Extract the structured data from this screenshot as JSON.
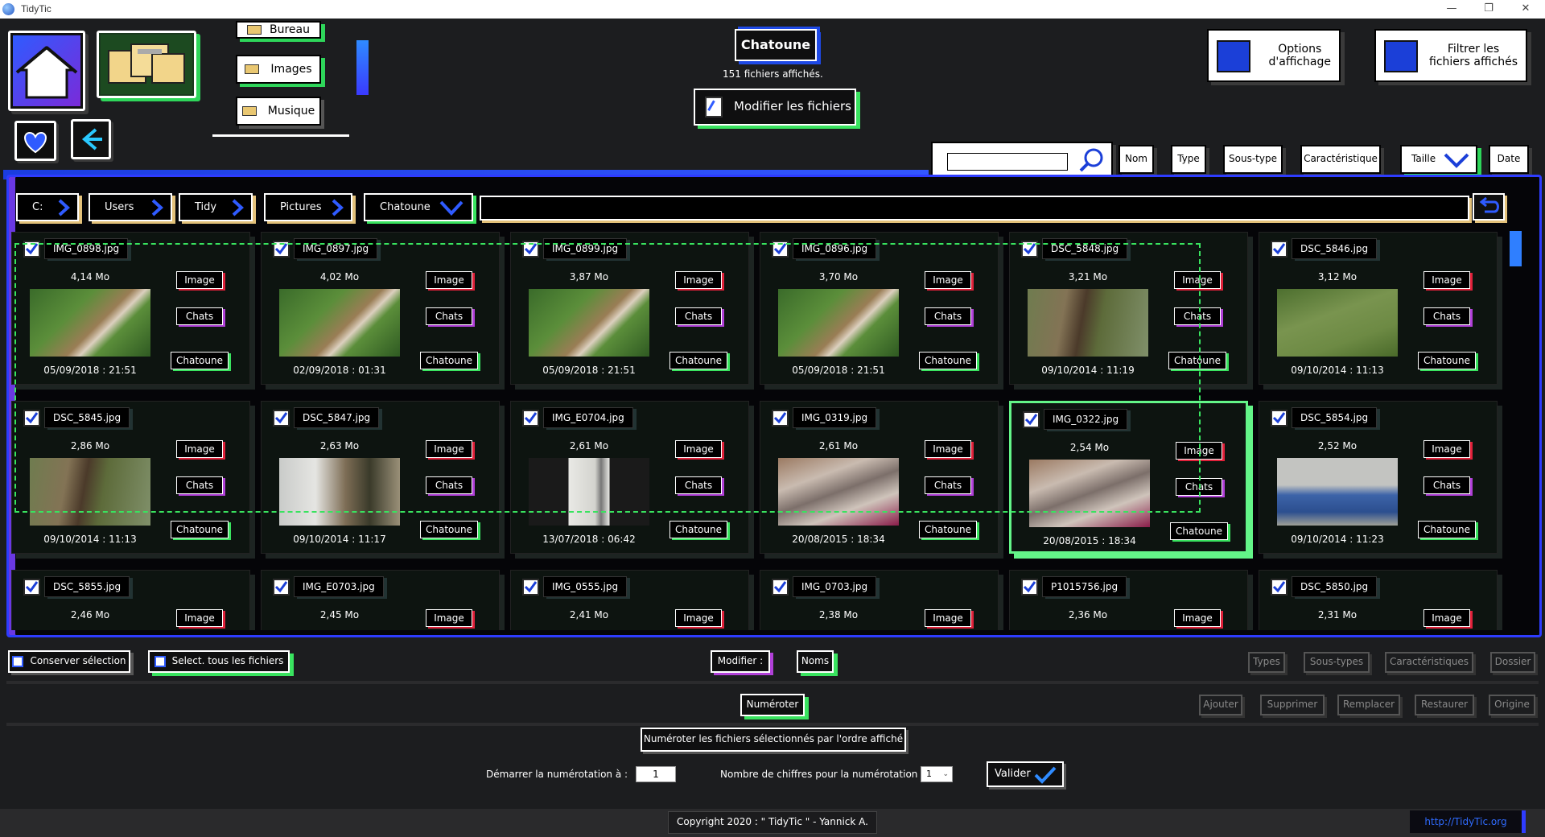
{
  "window": {
    "title": "TidyTic",
    "minimize": "—",
    "restore": "❐",
    "close": "✕"
  },
  "nav": {
    "shortcuts": [
      "Bureau",
      "Images",
      "Musique"
    ]
  },
  "current_folder": {
    "name": "Chatoune",
    "count_text": "151 fichiers affichés."
  },
  "actions": {
    "modify_files": "Modifier les fichiers"
  },
  "top_right": {
    "display_options": "Options\nd'affichage",
    "filter_files": "Filtrer les\nfichiers affichés"
  },
  "sort_buttons": [
    "Nom",
    "Type",
    "Sous-type",
    "Caractéristique",
    "Taille",
    "Date"
  ],
  "search": {
    "value": "",
    "placeholder": ""
  },
  "breadcrumb": [
    "C:",
    "Users",
    "Tidy",
    "Pictures",
    "Chatoune"
  ],
  "files": [
    {
      "name": "IMG_0898.jpg",
      "size": "4,14 Mo",
      "date": "05/09/2018 : 21:51",
      "type": "Image",
      "subtype": "Chats",
      "char": "Chatoune",
      "thumb": "garden"
    },
    {
      "name": "IMG_0897.jpg",
      "size": "4,02 Mo",
      "date": "02/09/2018 : 01:31",
      "type": "Image",
      "subtype": "Chats",
      "char": "Chatoune",
      "thumb": "garden"
    },
    {
      "name": "IMG_0899.jpg",
      "size": "3,87 Mo",
      "date": "05/09/2018 : 21:51",
      "type": "Image",
      "subtype": "Chats",
      "char": "Chatoune",
      "thumb": "garden"
    },
    {
      "name": "IMG_0896.jpg",
      "size": "3,70 Mo",
      "date": "05/09/2018 : 21:51",
      "type": "Image",
      "subtype": "Chats",
      "char": "Chatoune",
      "thumb": "garden"
    },
    {
      "name": "DSC_5848.jpg",
      "size": "3,21 Mo",
      "date": "09/10/2014 : 11:19",
      "type": "Image",
      "subtype": "Chats",
      "char": "Chatoune",
      "thumb": "tree"
    },
    {
      "name": "DSC_5846.jpg",
      "size": "3,12 Mo",
      "date": "09/10/2014 : 11:13",
      "type": "Image",
      "subtype": "Chats",
      "char": "Chatoune",
      "thumb": "grass"
    },
    {
      "name": "DSC_5845.jpg",
      "size": "2,86 Mo",
      "date": "09/10/2014 : 11:13",
      "type": "Image",
      "subtype": "Chats",
      "char": "Chatoune",
      "thumb": "tree"
    },
    {
      "name": "DSC_5847.jpg",
      "size": "2,63 Mo",
      "date": "09/10/2014 : 11:17",
      "type": "Image",
      "subtype": "Chats",
      "char": "Chatoune",
      "thumb": "yard"
    },
    {
      "name": "IMG_E0704.jpg",
      "size": "2,61 Mo",
      "date": "13/07/2018 : 06:42",
      "type": "Image",
      "subtype": "Chats",
      "char": "Chatoune",
      "thumb": "white"
    },
    {
      "name": "IMG_0319.jpg",
      "size": "2,61 Mo",
      "date": "20/08/2015 : 18:34",
      "type": "Image",
      "subtype": "Chats",
      "char": "Chatoune",
      "thumb": "fur"
    },
    {
      "name": "IMG_0322.jpg",
      "size": "2,54 Mo",
      "date": "20/08/2015 : 18:34",
      "type": "Image",
      "subtype": "Chats",
      "char": "Chatoune",
      "thumb": "fur"
    },
    {
      "name": "DSC_5854.jpg",
      "size": "2,52 Mo",
      "date": "09/10/2014 : 11:23",
      "type": "Image",
      "subtype": "Chats",
      "char": "Chatoune",
      "thumb": "crates"
    },
    {
      "name": "DSC_5855.jpg",
      "size": "2,46 Mo",
      "date": "",
      "type": "Image",
      "subtype": "",
      "char": "",
      "thumb": ""
    },
    {
      "name": "IMG_E0703.jpg",
      "size": "2,45 Mo",
      "date": "",
      "type": "Image",
      "subtype": "",
      "char": "",
      "thumb": ""
    },
    {
      "name": "IMG_0555.jpg",
      "size": "2,41 Mo",
      "date": "",
      "type": "Image",
      "subtype": "",
      "char": "",
      "thumb": ""
    },
    {
      "name": "IMG_0703.jpg",
      "size": "2,38 Mo",
      "date": "",
      "type": "Image",
      "subtype": "",
      "char": "",
      "thumb": ""
    },
    {
      "name": "P1015756.jpg",
      "size": "2,36 Mo",
      "date": "",
      "type": "Image",
      "subtype": "",
      "char": "",
      "thumb": ""
    },
    {
      "name": "DSC_5850.jpg",
      "size": "2,31 Mo",
      "date": "",
      "type": "Image",
      "subtype": "",
      "char": "",
      "thumb": ""
    }
  ],
  "selected_file_index": 10,
  "bottom": {
    "keep_selection": "Conserver sélection",
    "select_all": "Select. tous les fichiers",
    "modify_label": "Modifier :",
    "names": "Noms",
    "types": "Types",
    "subtypes": "Sous-types",
    "characteristics": "Caractéristiques",
    "folder": "Dossier",
    "number": "Numéroter",
    "add": "Ajouter",
    "delete": "Supprimer",
    "replace": "Remplacer",
    "restore": "Restaurer",
    "origin": "Origine",
    "number_desc": "Numéroter les fichiers sélectionnés par l'ordre affiché",
    "start_label": "Démarrer la numérotation à :",
    "start_value": "1",
    "digits_label": "Nombre de chiffres pour la numérotation :",
    "digits_value": "1",
    "validate": "Valider"
  },
  "footer": {
    "copyright": "Copyright 2020 : \" TidyTic \" - Yannick A.",
    "link": "http://TidyTic.org"
  },
  "colors": {
    "accent_blue": "#2e3cff",
    "accent_green": "#39e35f",
    "accent_red": "#e0213a",
    "accent_purple": "#b140d8"
  }
}
